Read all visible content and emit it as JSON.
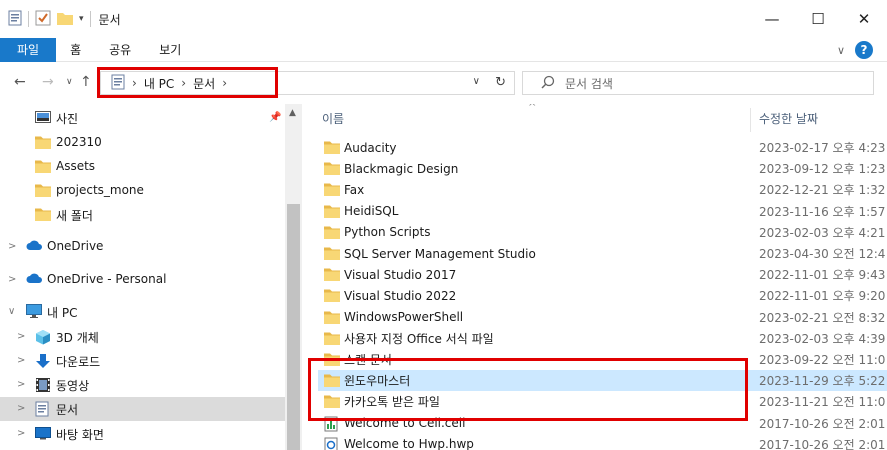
{
  "window": {
    "title": "문서",
    "controls": {
      "minimize": "—",
      "maximize": "☐",
      "close": "✕"
    }
  },
  "ribbon": {
    "tabs": [
      "파일",
      "홈",
      "공유",
      "보기"
    ],
    "expand_icon": "chevron-down-icon",
    "help_label": "?"
  },
  "address": {
    "crumbs": [
      "내 PC",
      "문서"
    ],
    "search_placeholder": "문서 검색"
  },
  "nav": {
    "items": [
      {
        "label": "사진",
        "icon": "pictures-icon"
      },
      {
        "label": "202310",
        "icon": "folder-icon"
      },
      {
        "label": "Assets",
        "icon": "folder-icon"
      },
      {
        "label": "projects_mone",
        "icon": "folder-icon"
      },
      {
        "label": "새 폴더",
        "icon": "folder-icon"
      },
      {
        "label": "OneDrive",
        "icon": "cloud-icon"
      },
      {
        "label": "OneDrive - Personal",
        "icon": "cloud-icon"
      },
      {
        "label": "내 PC",
        "icon": "pc-icon"
      },
      {
        "label": "3D 개체",
        "icon": "cube-icon"
      },
      {
        "label": "다운로드",
        "icon": "download-icon"
      },
      {
        "label": "동영상",
        "icon": "video-icon"
      },
      {
        "label": "문서",
        "icon": "document-icon",
        "selected": true
      },
      {
        "label": "바탕 화면",
        "icon": "desktop-icon"
      }
    ]
  },
  "columns": {
    "name": "이름",
    "date": "수정한 날짜"
  },
  "files": [
    {
      "name": "Audacity",
      "date": "2023-02-17 오후 4:23",
      "icon": "folder-icon"
    },
    {
      "name": "Blackmagic Design",
      "date": "2023-09-12 오후 1:23",
      "icon": "folder-icon"
    },
    {
      "name": "Fax",
      "date": "2022-12-21 오후 1:32",
      "icon": "folder-icon"
    },
    {
      "name": "HeidiSQL",
      "date": "2023-11-16 오후 1:57",
      "icon": "folder-icon"
    },
    {
      "name": "Python Scripts",
      "date": "2023-02-03 오후 4:21",
      "icon": "folder-icon"
    },
    {
      "name": "SQL Server Management Studio",
      "date": "2023-04-30 오전 12:4",
      "icon": "folder-icon"
    },
    {
      "name": "Visual Studio 2017",
      "date": "2022-11-01 오후 9:43",
      "icon": "folder-icon"
    },
    {
      "name": "Visual Studio 2022",
      "date": "2022-11-01 오후 9:20",
      "icon": "folder-icon"
    },
    {
      "name": "WindowsPowerShell",
      "date": "2023-02-21 오전 8:32",
      "icon": "folder-icon"
    },
    {
      "name": "사용자 지정 Office 서식 파일",
      "date": "2023-02-03 오후 4:39",
      "icon": "folder-icon"
    },
    {
      "name": "스캔 문서",
      "date": "2023-09-22 오전 11:0",
      "icon": "folder-icon"
    },
    {
      "name": "윈도우마스터",
      "date": "2023-11-29 오후 5:22",
      "icon": "folder-icon",
      "selected": true
    },
    {
      "name": "카카오톡 받은 파일",
      "date": "2023-11-21 오전 11:0",
      "icon": "folder-icon"
    },
    {
      "name": "Welcome to Cell.cell",
      "date": "2017-10-26 오전 2:01",
      "icon": "cell-file-icon"
    },
    {
      "name": "Welcome to Hwp.hwp",
      "date": "2017-10-26 오전 2:01",
      "icon": "hwp-file-icon"
    }
  ],
  "colors": {
    "accent": "#1979ca",
    "selection": "#cce8ff",
    "highlight_box": "#e00000",
    "folder": "#f8d775"
  }
}
